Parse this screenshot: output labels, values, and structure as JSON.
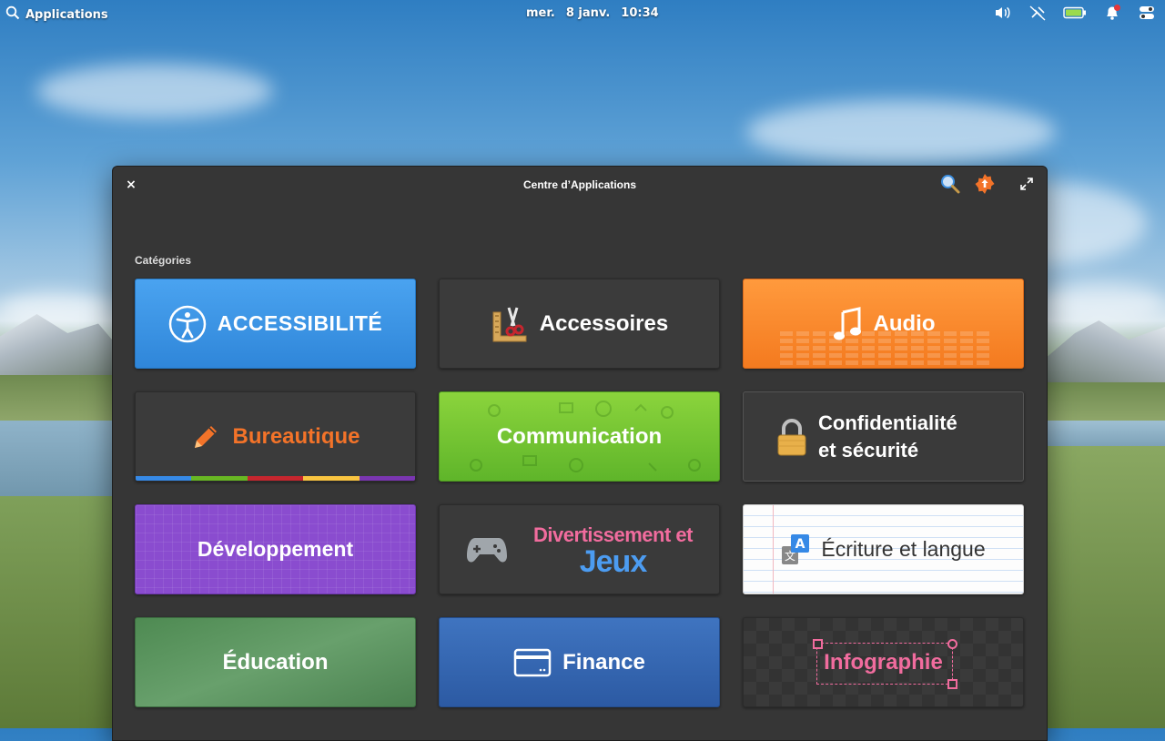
{
  "panel": {
    "applications_label": "Applications",
    "day": "mer.",
    "date": "8 janv.",
    "time": "10:34",
    "indicators": [
      "volume-icon",
      "network-icon",
      "battery-icon",
      "notifications-icon",
      "session-icon"
    ]
  },
  "window": {
    "title": "Centre d’Applications",
    "close_label": "×",
    "categories_label": "Catégories"
  },
  "categories": [
    {
      "label": "ACCESSIBILITÉ",
      "icon": "accessibility-icon",
      "color": "#3689e6"
    },
    {
      "label": "Accessoires",
      "icon": "accessories-icon"
    },
    {
      "label": "Audio",
      "icon": "music-note-icon",
      "color": "#f37329"
    },
    {
      "label": "Bureautique",
      "icon": "pencil-icon",
      "color": "#f37329"
    },
    {
      "label": "Communication",
      "icon": "chat-icon",
      "color": "#68b723"
    },
    {
      "label_line1": "Confidentialité",
      "label_line2": "et sécurité",
      "icon": "padlock-icon"
    },
    {
      "label": "Développement",
      "icon": "grid-icon",
      "color": "#7a36b1"
    },
    {
      "label_line1": "Divertissement et",
      "label_line2": "Jeux",
      "icon": "gamepad-icon"
    },
    {
      "label": "Écriture et langue",
      "icon": "translate-icon"
    },
    {
      "label": "Éducation",
      "icon": "chalkboard-icon",
      "color": "#4e8a52"
    },
    {
      "label": "Finance",
      "icon": "credit-card-icon",
      "color": "#3567b5"
    },
    {
      "label": "Infographie",
      "icon": "selection-box-icon",
      "color": "#f16c9e"
    }
  ]
}
